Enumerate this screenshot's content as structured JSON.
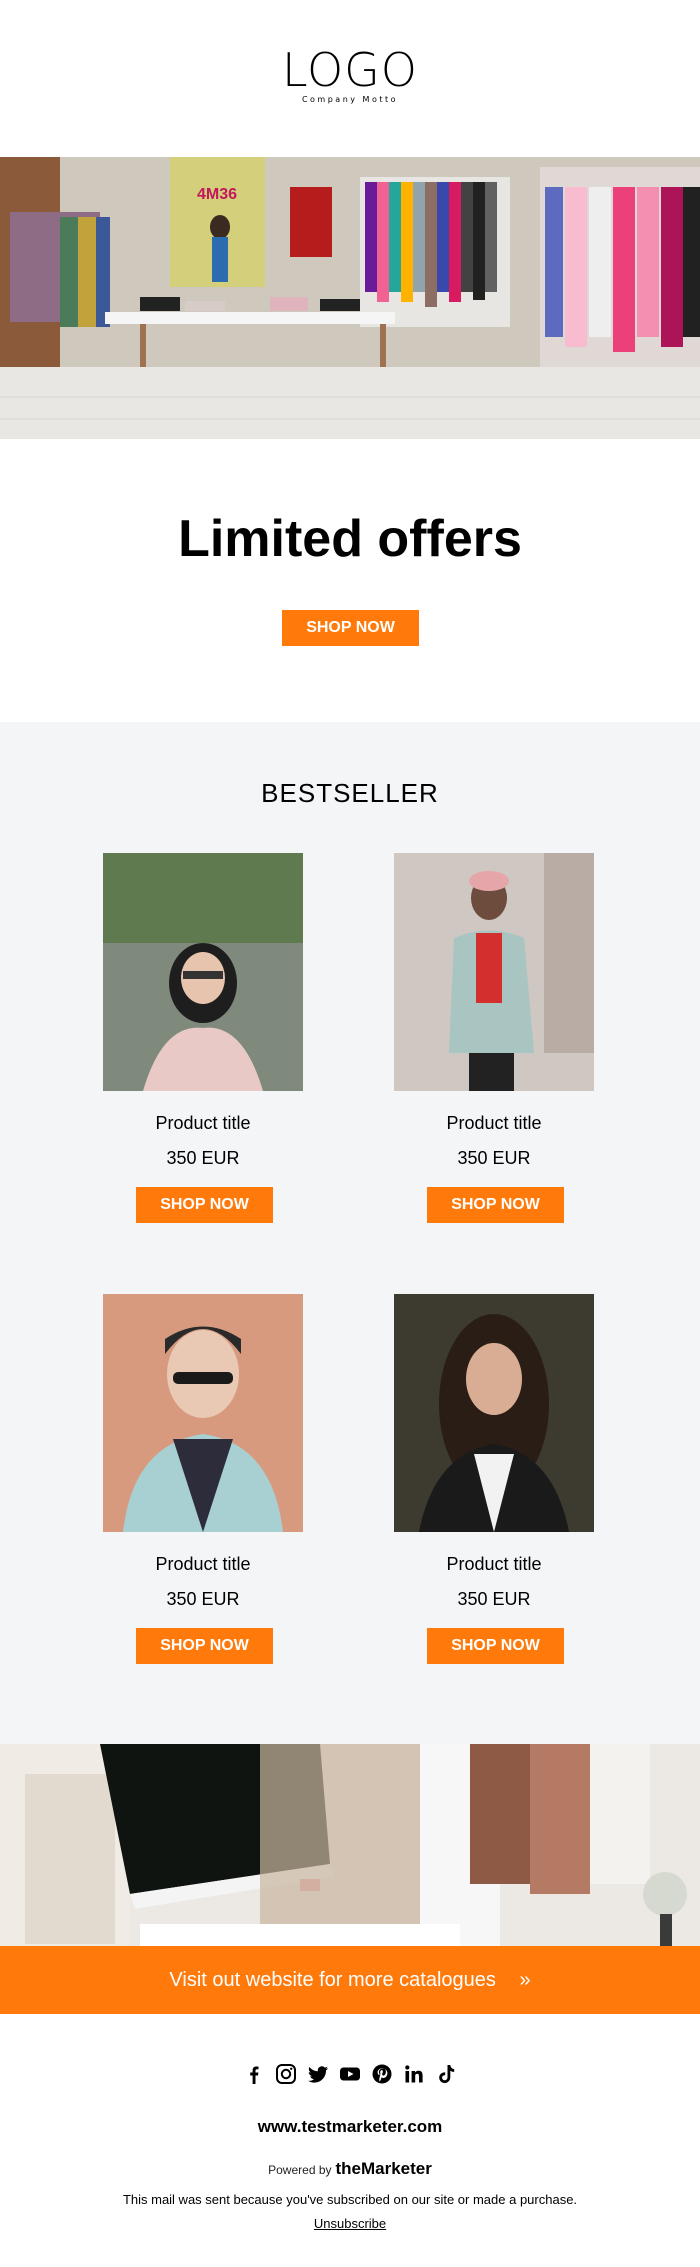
{
  "header": {
    "logo_text": "LOGO",
    "motto": "Company Motto"
  },
  "hero": {
    "store_sign": "4M36"
  },
  "offers": {
    "title": "Limited offers",
    "button": "SHOP NOW"
  },
  "bestseller": {
    "title": "BESTSELLER",
    "products": [
      {
        "title": "Product title",
        "price": "350 EUR",
        "button": "SHOP NOW"
      },
      {
        "title": "Product title",
        "price": "350 EUR",
        "button": "SHOP NOW"
      },
      {
        "title": "Product title",
        "price": "350 EUR",
        "button": "SHOP NOW"
      },
      {
        "title": "Product title",
        "price": "350 EUR",
        "button": "SHOP NOW"
      }
    ]
  },
  "cta": {
    "text": "Visit out website for more catalogues",
    "arrow": "»"
  },
  "footer": {
    "social_icons": [
      "facebook-icon",
      "instagram-icon",
      "twitter-icon",
      "youtube-icon",
      "pinterest-icon",
      "linkedin-icon",
      "tiktok-icon"
    ],
    "url": "www.testmarketer.com",
    "powered_by": "Powered by",
    "brand": "theMarketer",
    "note": "This mail was sent because you've subscribed on our site or made a purchase.",
    "unsubscribe": "Unsubscribe"
  },
  "colors": {
    "accent": "#ff7a0a",
    "section_bg": "#f3f5f7"
  }
}
